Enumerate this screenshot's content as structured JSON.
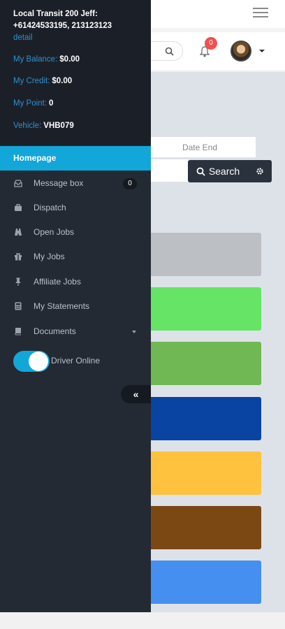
{
  "header": {
    "notification_count": "0"
  },
  "filters": {
    "date_end_placeholder": "Date End",
    "search_label": "Search"
  },
  "tiles": [
    {
      "color": "#bcbfc3"
    },
    {
      "color": "#65e466"
    },
    {
      "color": "#6fb853"
    },
    {
      "color": "#0944a2"
    },
    {
      "color": "#fec23e"
    },
    {
      "color": "#7b4813"
    },
    {
      "color": "#458ff0"
    }
  ],
  "sidebar": {
    "user_line1": "Local Transit 200 Jeff:",
    "user_line2": "+61424533195, 213123123",
    "detail_link": "detail",
    "balance_label": "My Balance:",
    "balance_value": "$0.00",
    "credit_label": "My Credit:",
    "credit_value": "$0.00",
    "point_label": "My Point:",
    "point_value": "0",
    "vehicle_label": "Vehicle:",
    "vehicle_value": "VHB079",
    "homepage": "Homepage",
    "items": [
      {
        "label": "Message box",
        "icon": "inbox-icon",
        "badge": "0"
      },
      {
        "label": "Dispatch",
        "icon": "briefcase-icon"
      },
      {
        "label": "Open Jobs",
        "icon": "road-icon"
      },
      {
        "label": "My Jobs",
        "icon": "gift-icon"
      },
      {
        "label": "Affiliate Jobs",
        "icon": "pin-icon"
      },
      {
        "label": "My Statements",
        "icon": "calculator-icon"
      },
      {
        "label": "Documents",
        "icon": "book-icon"
      }
    ],
    "driver_online_label": "Driver Online",
    "collapse_icon": "«"
  },
  "colors": {
    "accent": "#13a6d9",
    "sidebar_bg": "#242a33",
    "sidebar_header_bg": "#1b2028",
    "link": "#2f8fd0",
    "notification": "#f05050"
  }
}
